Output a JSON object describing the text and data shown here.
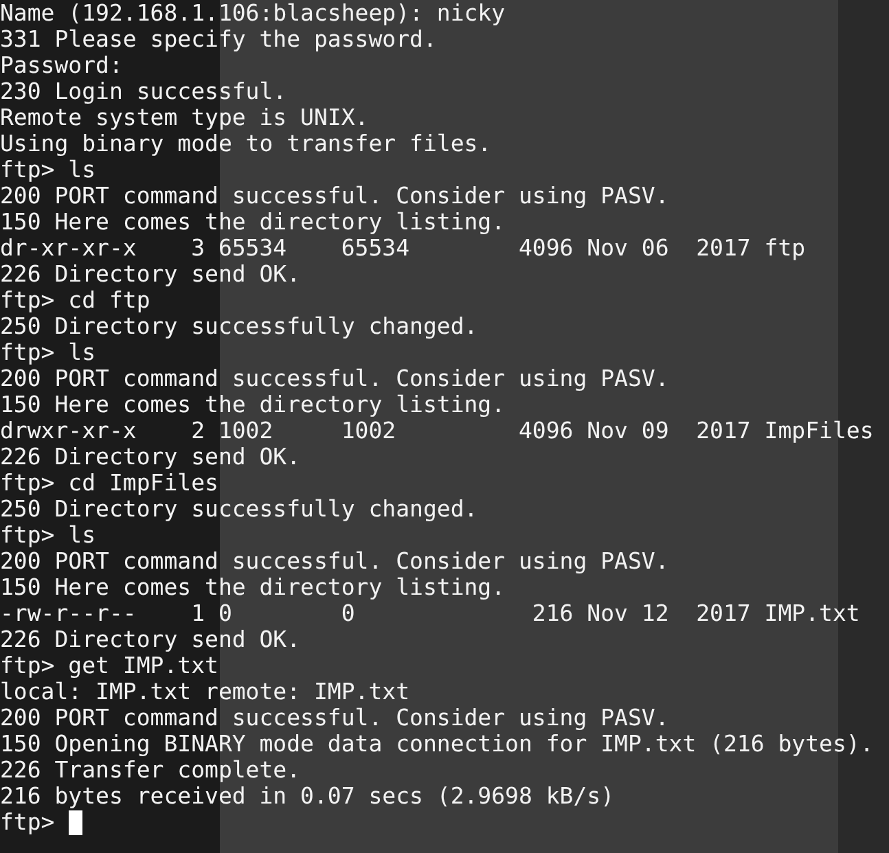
{
  "terminal": {
    "lines": [
      "Name (192.168.1.106:blacsheep): nicky",
      "331 Please specify the password.",
      "Password:",
      "230 Login successful.",
      "Remote system type is UNIX.",
      "Using binary mode to transfer files.",
      "ftp> ls",
      "200 PORT command successful. Consider using PASV.",
      "150 Here comes the directory listing.",
      "dr-xr-xr-x    3 65534    65534        4096 Nov 06  2017 ftp",
      "226 Directory send OK.",
      "ftp> cd ftp",
      "250 Directory successfully changed.",
      "ftp> ls",
      "200 PORT command successful. Consider using PASV.",
      "150 Here comes the directory listing.",
      "drwxr-xr-x    2 1002     1002         4096 Nov 09  2017 ImpFiles",
      "226 Directory send OK.",
      "ftp> cd ImpFiles",
      "250 Directory successfully changed.",
      "ftp> ls",
      "200 PORT command successful. Consider using PASV.",
      "150 Here comes the directory listing.",
      "-rw-r--r--    1 0        0             216 Nov 12  2017 IMP.txt",
      "226 Directory send OK.",
      "ftp> get IMP.txt",
      "local: IMP.txt remote: IMP.txt",
      "200 PORT command successful. Consider using PASV.",
      "150 Opening BINARY mode data connection for IMP.txt (216 bytes).",
      "226 Transfer complete.",
      "216 bytes received in 0.07 secs (2.9698 kB/s)",
      "ftp>"
    ],
    "cursor": true
  }
}
